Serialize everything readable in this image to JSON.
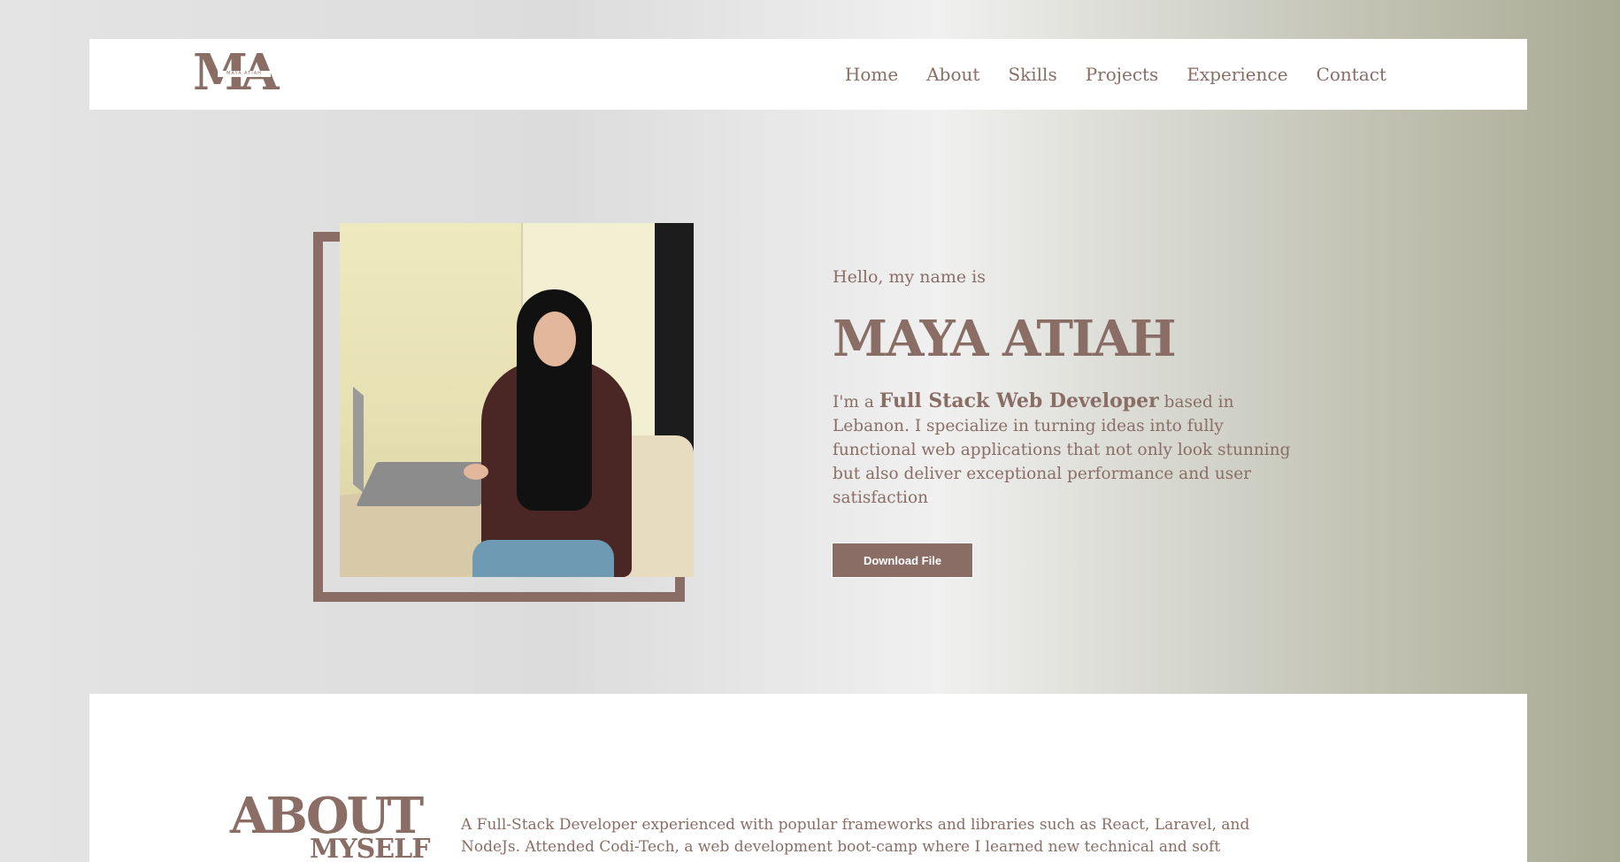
{
  "navbar": {
    "logo_mark": "MA",
    "logo_sub": "MAYA ATIAH",
    "links": [
      "Home",
      "About",
      "Skills",
      "Projects",
      "Experience",
      "Contact"
    ]
  },
  "hero": {
    "greeting": "Hello, my name is",
    "name": "MAYA ATIAH",
    "intro_prefix": "I'm a ",
    "intro_role": "Full Stack Web Developer",
    "intro_suffix": " based in Lebanon. I specialize in turning ideas into fully functional web applications that not only look stunning but also deliver exceptional performance and user satisfaction",
    "download_label": "Download File"
  },
  "about": {
    "title_big": "ABOUT",
    "title_small": "MYSELF",
    "text": "A Full-Stack Developer experienced with popular frameworks and libraries such as React, Laravel, and NodeJs. Attended Codi-Tech, a web development boot-camp where I learned new technical and soft skills"
  },
  "colors": {
    "accent": "#8a6e66",
    "navbar_bg": "#ffffff",
    "button_text": "#ffffff"
  }
}
